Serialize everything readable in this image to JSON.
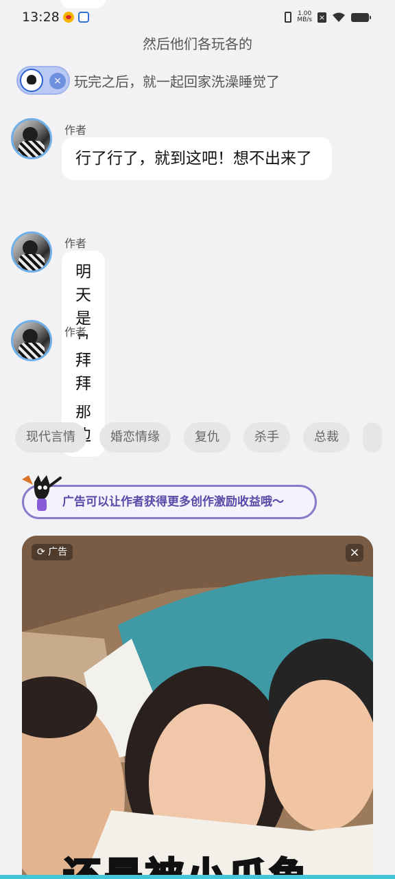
{
  "status_bar": {
    "time": "13:28",
    "net_speed_value": "1.00",
    "net_speed_unit": "MB/s"
  },
  "narration": {
    "line1": "然后他们各玩各的",
    "line2": "玩完之后，就一起回家洗澡睡觉了"
  },
  "messages": [
    {
      "author": "作者",
      "text": "行了行了，就到这吧！想不出来了"
    },
    {
      "author": "作者",
      "text": "明天是马嘉祺那边"
    },
    {
      "author": "作者",
      "text": "拜拜"
    }
  ],
  "tags": [
    "现代言情",
    "婚恋情缘",
    "复仇",
    "杀手",
    "总裁"
  ],
  "ad_banner": {
    "text": "广告可以让作者获得更多创作激励收益哦～"
  },
  "ad_card": {
    "label": "广告",
    "close": "×",
    "caption": "还是被小爪鱼"
  },
  "colors": {
    "background": "#f2f2f4",
    "bubble": "#ffffff",
    "avatar_ring": "#6fb0e8",
    "ad_banner_border": "#8b79c9",
    "ad_banner_text": "#5a48a8",
    "bottom_bar": "#43c7d8"
  }
}
